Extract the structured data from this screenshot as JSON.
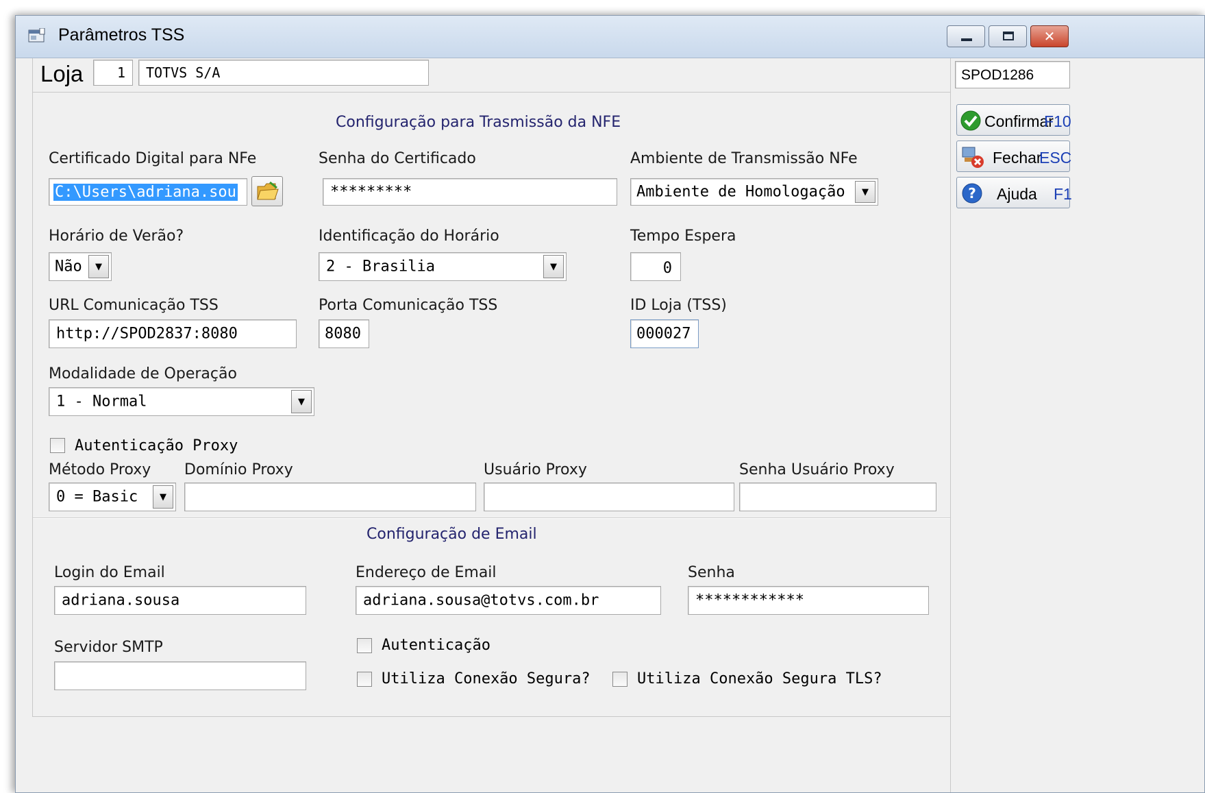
{
  "window": {
    "title": "Parâmetros TSS",
    "controls": {
      "minimize": "minimize",
      "maximize": "maximize",
      "close": "close"
    }
  },
  "header": {
    "loja_label": "Loja",
    "loja_code": "1",
    "loja_name": "TOTVS S/A",
    "server_name": "SPOD1286"
  },
  "nfe_section": {
    "title": "Configuração para Trasmissão da NFE",
    "certificado_label": "Certificado Digital para NFe",
    "certificado_value": "C:\\Users\\adriana.sou",
    "senha_cert_label": "Senha do Certificado",
    "senha_cert_value": "*********",
    "ambiente_label": "Ambiente de Transmissão NFe",
    "ambiente_value": "Ambiente de Homologação",
    "horario_verao_label": "Horário de Verão?",
    "horario_verao_value": "Não",
    "id_horario_label": "Identificação do Horário",
    "id_horario_value": "2 - Brasilia",
    "tempo_espera_label": "Tempo Espera",
    "tempo_espera_value": "0",
    "url_label": "URL Comunicação TSS",
    "url_value": "http://SPOD2837:8080",
    "porta_label": "Porta Comunicação TSS",
    "porta_value": "8080",
    "id_loja_label": "ID Loja (TSS)",
    "id_loja_value": "000027",
    "modalidade_label": "Modalidade de Operação",
    "modalidade_value": "1 - Normal",
    "auth_proxy_label": "Autenticação Proxy",
    "auth_proxy_checked": false,
    "metodo_proxy_label": "Método Proxy",
    "metodo_proxy_value": "0 = Basic",
    "dominio_proxy_label": "Domínio Proxy",
    "dominio_proxy_value": "",
    "usuario_proxy_label": "Usuário Proxy",
    "usuario_proxy_value": "",
    "senha_proxy_label": "Senha Usuário Proxy",
    "senha_proxy_value": ""
  },
  "email_section": {
    "title": "Configuração de Email",
    "login_label": "Login do Email",
    "login_value": "adriana.sousa",
    "endereco_label": "Endereço de Email",
    "endereco_value": "adriana.sousa@totvs.com.br",
    "senha_label": "Senha",
    "senha_value": "************",
    "smtp_label": "Servidor SMTP",
    "smtp_value": "",
    "autenticacao_label": "Autenticação",
    "autenticacao_checked": false,
    "conexao_segura_label": "Utiliza Conexão Segura?",
    "conexao_segura_checked": false,
    "conexao_tls_label": "Utiliza Conexão Segura TLS?",
    "conexao_tls_checked": false
  },
  "side_buttons": {
    "confirmar_label": "Confirmar",
    "confirmar_key": "F10",
    "fechar_label": "Fechar",
    "fechar_key": "ESC",
    "ajuda_label": "Ajuda",
    "ajuda_key": "F1"
  },
  "icons": {
    "app": "window-app-icon",
    "folder": "folder-open-icon",
    "confirm": "check-circle-icon",
    "close": "close-x-icon",
    "help": "help-question-icon",
    "dropdown": "chevron-down-icon"
  },
  "colors": {
    "section_title": "#24246e",
    "shortcut_key": "#1b3fb5",
    "selection": "#3399ff",
    "confirm_green": "#2e9b2e",
    "close_red": "#d83b2b",
    "help_blue": "#2b67c9"
  }
}
